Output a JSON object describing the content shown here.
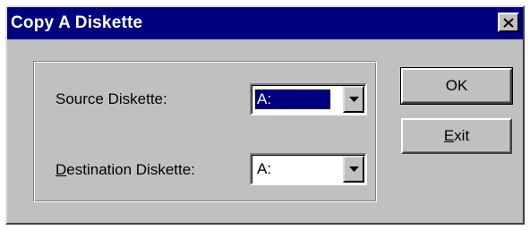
{
  "dialog": {
    "title": "Copy A Diskette",
    "close_symbol": "close-icon"
  },
  "source": {
    "label_prefix": "Source Diskette:",
    "value": "A:"
  },
  "destination": {
    "label_mnemonic": "D",
    "label_rest": "estination Diskette:",
    "value": "A:"
  },
  "buttons": {
    "ok": "OK",
    "exit_mnemonic": "E",
    "exit_rest": "xit"
  },
  "colors": {
    "titlebar": "#000080",
    "face": "#c0c0c0",
    "selection": "#000080"
  },
  "icons": [
    "close-icon",
    "dropdown-arrow-icon"
  ]
}
